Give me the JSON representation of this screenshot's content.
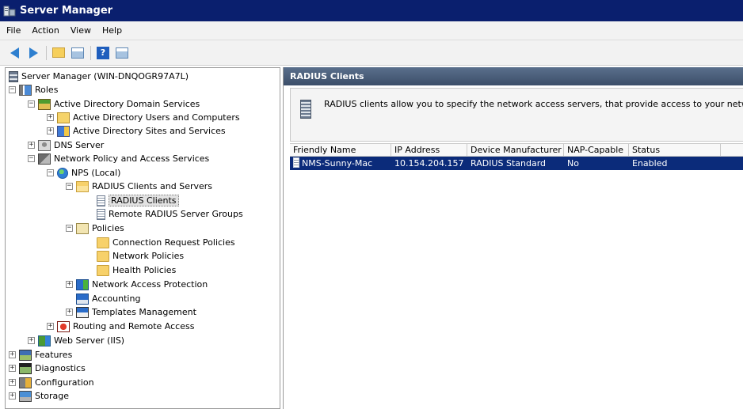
{
  "window": {
    "title": "Server Manager",
    "app_icon": "server-manager-icon"
  },
  "menu": [
    "File",
    "Action",
    "View",
    "Help"
  ],
  "toolbar": {
    "buttons": [
      "back-icon",
      "forward-icon",
      "up-folder-icon",
      "show-hide-console-tree-icon",
      "help-icon",
      "show-hide-action-pane-icon"
    ],
    "help_label": "?"
  },
  "tree": {
    "items": [
      {
        "label": "Server Manager (WIN-DNQOGR97A7L)",
        "icon": "server-icon",
        "expander": "",
        "level": 0
      },
      {
        "label": "Roles",
        "icon": "roles-icon",
        "expander": "⊟",
        "level": 0
      },
      {
        "label": "Active Directory Domain Services",
        "icon": "ad-ds-icon",
        "expander": "⊟",
        "level": 1
      },
      {
        "label": "Active Directory Users and Computers",
        "icon": "ad-users-icon",
        "expander": "⊞",
        "level": 2
      },
      {
        "label": "Active Directory Sites and Services",
        "icon": "ad-sites-icon",
        "expander": "⊞",
        "level": 2
      },
      {
        "label": "DNS Server",
        "icon": "dns-server-icon",
        "expander": "⊞",
        "level": 1
      },
      {
        "label": "Network Policy and Access Services",
        "icon": "npas-icon",
        "expander": "⊟",
        "level": 1
      },
      {
        "label": "NPS (Local)",
        "icon": "nps-globe-icon",
        "expander": "⊟",
        "level": 2
      },
      {
        "label": "RADIUS Clients and Servers",
        "icon": "folder-open-icon",
        "expander": "⊟",
        "level": 3
      },
      {
        "label": "RADIUS Clients",
        "icon": "radius-clients-icon",
        "expander": "",
        "level": 4,
        "selected": true
      },
      {
        "label": "Remote RADIUS Server Groups",
        "icon": "radius-server-groups-icon",
        "expander": "",
        "level": 4
      },
      {
        "label": "Policies",
        "icon": "policies-icon",
        "expander": "⊟",
        "level": 3
      },
      {
        "label": "Connection Request Policies",
        "icon": "folder-icon",
        "expander": "",
        "level": 4
      },
      {
        "label": "Network Policies",
        "icon": "folder-icon",
        "expander": "",
        "level": 4
      },
      {
        "label": "Health Policies",
        "icon": "folder-icon",
        "expander": "",
        "level": 4
      },
      {
        "label": "Network Access Protection",
        "icon": "nap-icon",
        "expander": "⊞",
        "level": 3
      },
      {
        "label": "Accounting",
        "icon": "accounting-icon",
        "expander": "",
        "level": 3
      },
      {
        "label": "Templates Management",
        "icon": "templates-icon",
        "expander": "⊞",
        "level": 3
      },
      {
        "label": "Routing and Remote Access",
        "icon": "routing-remote-access-icon",
        "expander": "⊞",
        "level": 2
      },
      {
        "label": "Web Server (IIS)",
        "icon": "web-server-iis-icon",
        "expander": "⊞",
        "level": 1
      },
      {
        "label": "Features",
        "icon": "features-icon",
        "expander": "⊞",
        "level": 0
      },
      {
        "label": "Diagnostics",
        "icon": "diagnostics-icon",
        "expander": "⊞",
        "level": 0
      },
      {
        "label": "Configuration",
        "icon": "configuration-icon",
        "expander": "⊞",
        "level": 0
      },
      {
        "label": "Storage",
        "icon": "storage-icon",
        "expander": "⊞",
        "level": 0
      }
    ]
  },
  "right": {
    "header": "RADIUS Clients",
    "info_text": "RADIUS clients allow you to specify the network access servers, that provide access to your network",
    "columns": [
      "Friendly Name",
      "IP Address",
      "Device Manufacturer",
      "NAP-Capable",
      "Status",
      ""
    ],
    "rows": [
      {
        "cells": [
          "NMS-Sunny-Mac",
          "10.154.204.157",
          "RADIUS Standard",
          "No",
          "Enabled",
          ""
        ],
        "selected": true
      }
    ]
  }
}
